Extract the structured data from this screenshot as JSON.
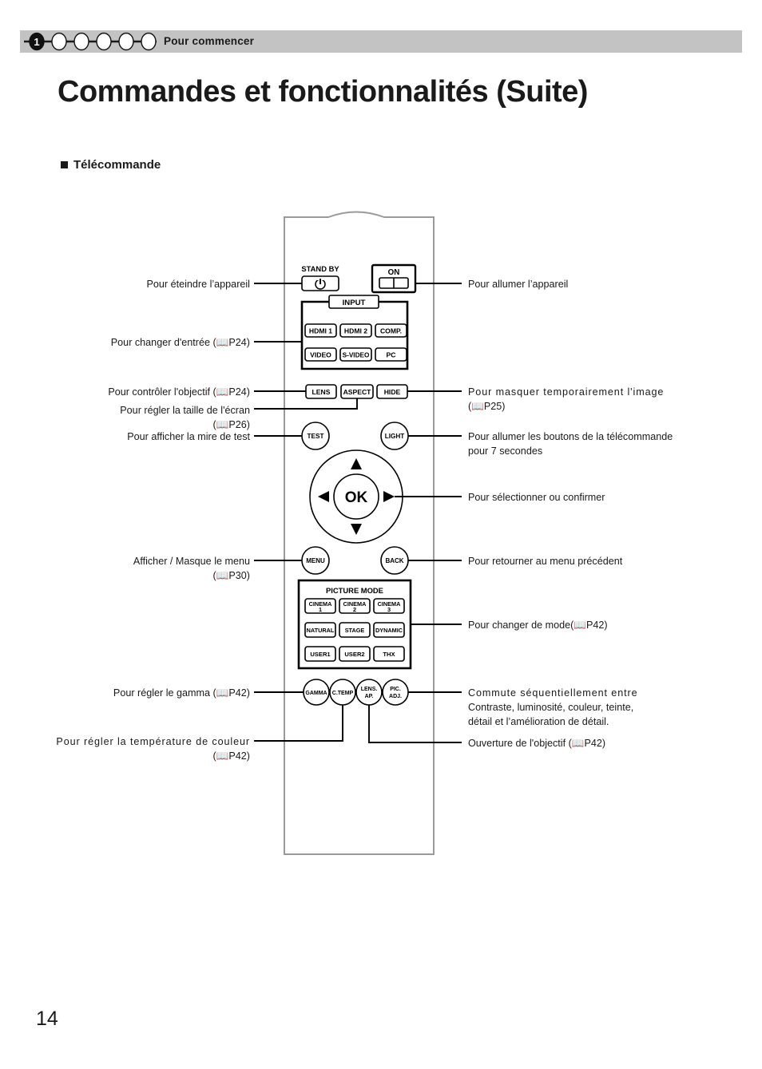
{
  "header": {
    "chapter_number": "1",
    "step_count": 6,
    "title": "Pour commencer"
  },
  "page": {
    "title": "Commandes et fonctionnalités (Suite)",
    "section_heading": "Télécommande",
    "page_number": "14"
  },
  "remote": {
    "standby_label": "STAND BY",
    "on_label": "ON",
    "power_icon": "power-icon",
    "input_group_label": "INPUT",
    "input_buttons": [
      "HDMI 1",
      "HDMI 2",
      "COMP.",
      "VIDEO",
      "S-VIDEO",
      "PC"
    ],
    "control_buttons": [
      "LENS",
      "ASPECT",
      "HIDE"
    ],
    "test_label": "TEST",
    "light_label": "LIGHT",
    "ok_label": "OK",
    "arrow_up": "▲",
    "arrow_down": "▼",
    "arrow_left": "◀",
    "arrow_right": "▶",
    "menu_label": "MENU",
    "back_label": "BACK",
    "picture_mode_label": "PICTURE MODE",
    "picture_mode_buttons": [
      {
        "line1": "CINEMA",
        "line2": "1"
      },
      {
        "line1": "CINEMA",
        "line2": "2"
      },
      {
        "line1": "CINEMA",
        "line2": "3"
      },
      {
        "line1": "NATURAL",
        "line2": ""
      },
      {
        "line1": "STAGE",
        "line2": ""
      },
      {
        "line1": "DYNAMIC",
        "line2": ""
      },
      {
        "line1": "USER1",
        "line2": ""
      },
      {
        "line1": "USER2",
        "line2": ""
      },
      {
        "line1": "THX",
        "line2": ""
      }
    ],
    "bottom_buttons": [
      {
        "line1": "GAMMA",
        "line2": ""
      },
      {
        "line1": "C.TEMP",
        "line2": ""
      },
      {
        "line1": "LENS.",
        "line2": "AP."
      },
      {
        "line1": "PIC.",
        "line2": "ADJ."
      }
    ]
  },
  "callouts_left": [
    {
      "id": "power-off",
      "lines": [
        "Pour éteindre l’appareil"
      ]
    },
    {
      "id": "change-input",
      "lines": [
        "Pour changer d'entrée (📖P24)"
      ]
    },
    {
      "id": "lens-control",
      "lines": [
        "Pour contrôler l'objectif (📖P24)"
      ]
    },
    {
      "id": "screen-size",
      "lines": [
        "Pour régler la taille de l'écran",
        "(📖P26)"
      ]
    },
    {
      "id": "test-pattern",
      "lines": [
        "Pour afficher la mire de test"
      ]
    },
    {
      "id": "menu-toggle",
      "lines": [
        "Afficher / Masque le menu",
        "(📖P30)"
      ]
    },
    {
      "id": "gamma",
      "lines": [
        "Pour régler le gamma (📖P42)"
      ]
    },
    {
      "id": "color-temp",
      "lines": [
        "Pour régler la température de couleur",
        "(📖P42)"
      ]
    }
  ],
  "callouts_right": [
    {
      "id": "power-on",
      "lines": [
        "Pour allumer l’appareil"
      ]
    },
    {
      "id": "hide-image",
      "lines": [
        "Pour masquer temporairement l'image",
        "(📖P25)"
      ]
    },
    {
      "id": "light-buttons",
      "lines": [
        "Pour allumer les boutons de la télécommande",
        "pour 7 secondes"
      ]
    },
    {
      "id": "select-confirm",
      "lines": [
        "Pour sélectionner ou confirmer"
      ]
    },
    {
      "id": "back-menu",
      "lines": [
        "Pour retourner au menu précédent"
      ]
    },
    {
      "id": "change-mode",
      "lines": [
        "Pour changer de mode(📖P42)"
      ]
    },
    {
      "id": "pic-adj",
      "lines": [
        "Commute séquentiellement entre",
        "Contraste, luminosité, couleur, teinte,",
        "détail et l’amélioration de détail."
      ]
    },
    {
      "id": "lens-aperture",
      "lines": [
        "Ouverture de l'objectif (📖P42)"
      ]
    }
  ]
}
